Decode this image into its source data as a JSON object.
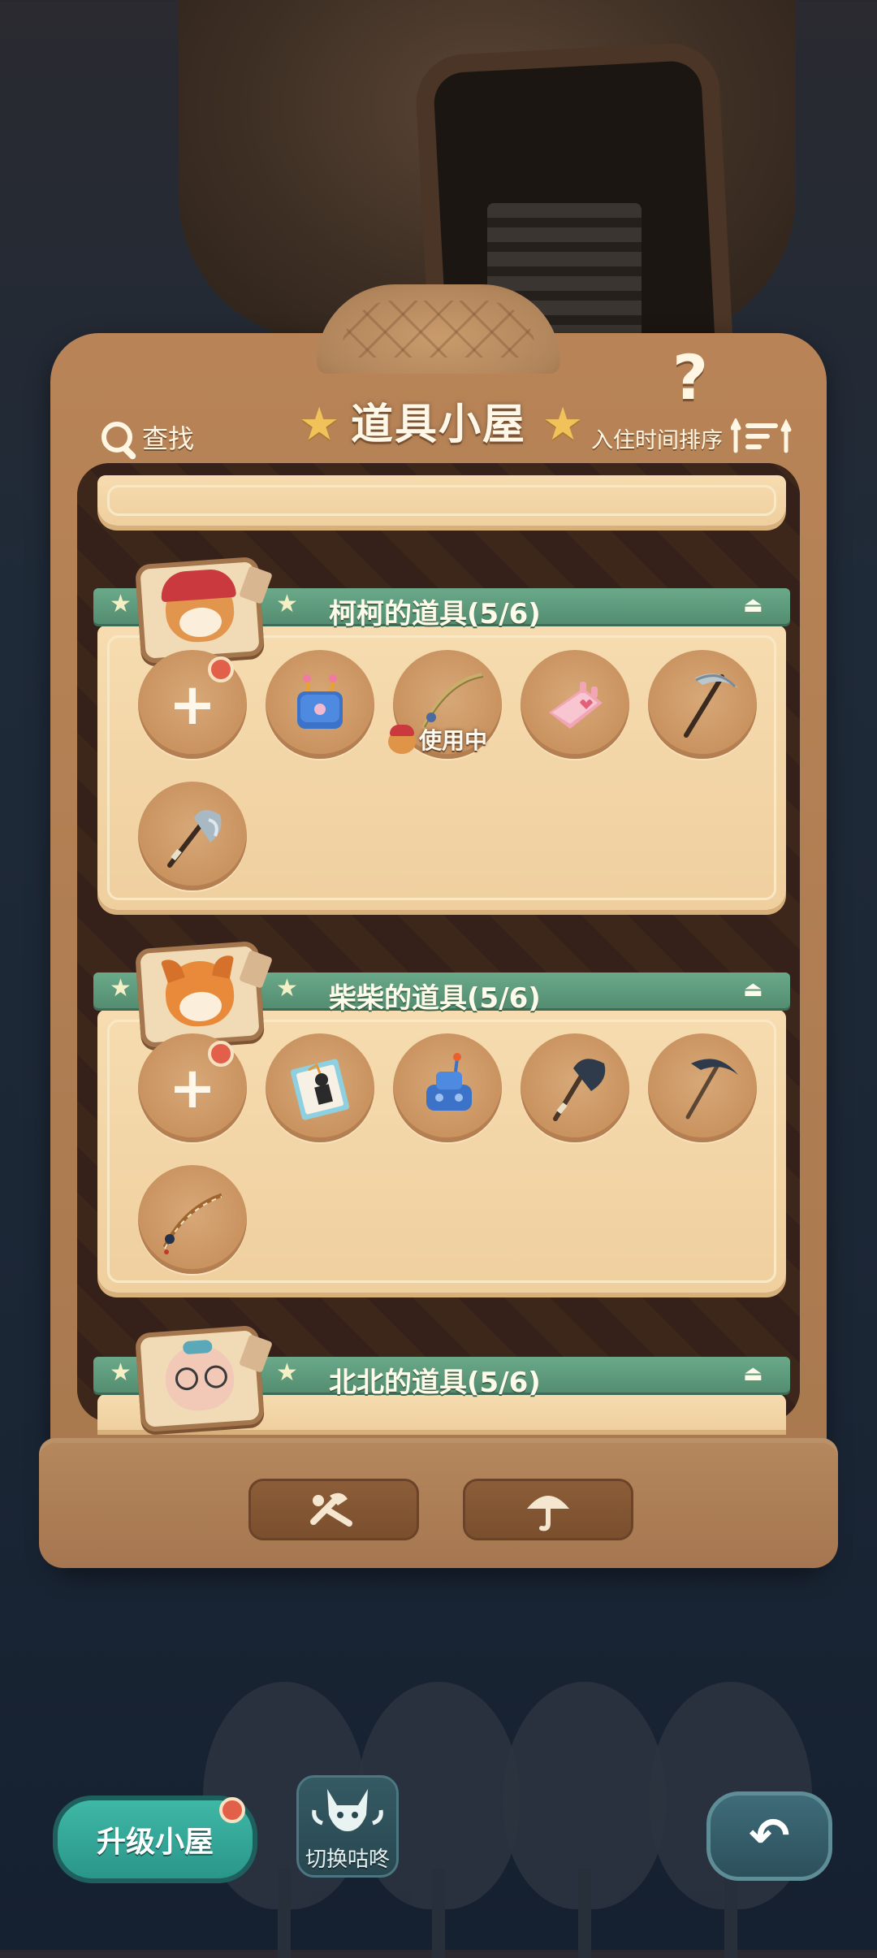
{
  "header": {
    "title": "道具小屋",
    "search_label": "查找",
    "sort_label": "入住时间排序",
    "help": "?"
  },
  "sections": [
    {
      "label": "柯柯的道具(5/6)",
      "items": [
        {
          "icon": "add-slot",
          "text": "+"
        },
        {
          "icon": "blue-game-console"
        },
        {
          "icon": "fishing-rod"
        },
        {
          "icon": "pink-game-console"
        },
        {
          "icon": "pickaxe"
        },
        {
          "icon": "axe"
        }
      ],
      "in_use_label": "使用中"
    },
    {
      "label": "柴柴的道具(5/6)",
      "items": [
        {
          "icon": "add-slot",
          "text": "+"
        },
        {
          "icon": "card-pack"
        },
        {
          "icon": "blue-game-console"
        },
        {
          "icon": "dark-axe"
        },
        {
          "icon": "dark-pickaxe"
        },
        {
          "icon": "fishing-rod"
        }
      ]
    },
    {
      "label": "北北的道具(5/6)"
    }
  ],
  "bottom": {
    "upgrade_label": "升级小屋",
    "switch_label": "切换咕咚",
    "back": "↶"
  },
  "colors": {
    "banner": "#5f9c7e",
    "panel": "#f3d7a8",
    "cabinet": "#b07f53",
    "accent_teal": "#2f9f90"
  }
}
